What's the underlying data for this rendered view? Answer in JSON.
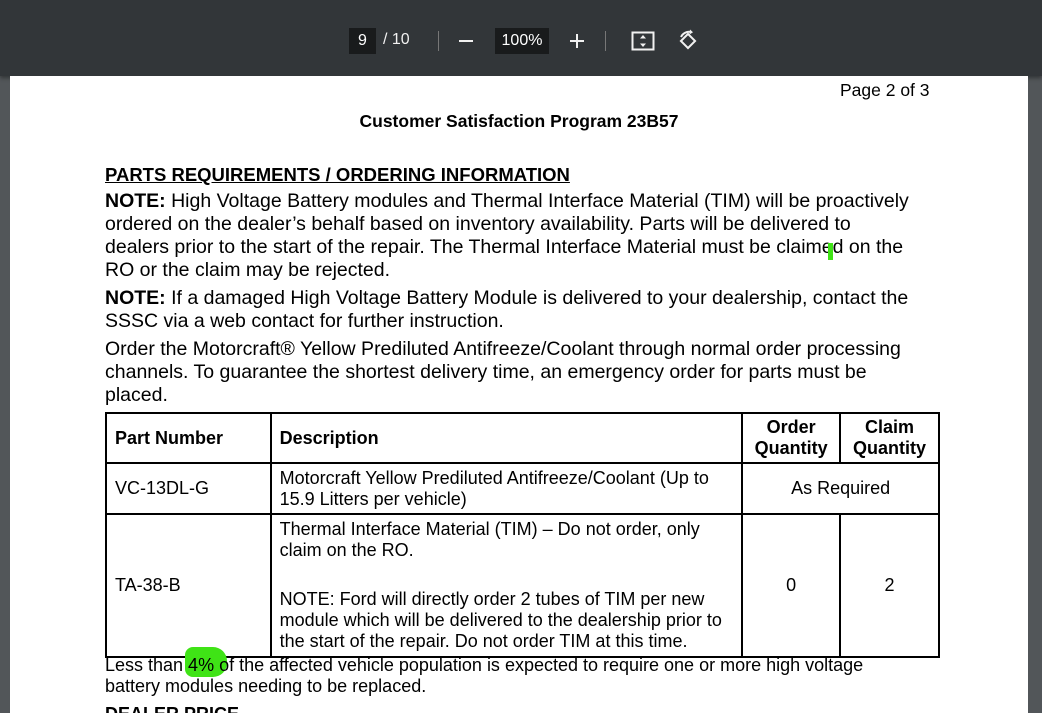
{
  "toolbar": {
    "page_current": "9",
    "page_total": "/ 10",
    "zoom": "100%",
    "icons": [
      "minus-icon",
      "plus-icon",
      "fit-page-icon",
      "rotate-icon"
    ]
  },
  "document": {
    "page_label": "Page 2 of 3",
    "title": "Customer Satisfaction Program 23B57",
    "section_heading": "PARTS REQUIREMENTS / ORDERING INFORMATION",
    "note1_label": "NOTE:",
    "note1_lines": [
      " High Voltage Battery modules and Thermal Interface Material (TIM) will be proactively",
      "ordered on the dealer’s behalf based on inventory availability. Parts will be delivered to",
      "dealers prior to the start of the repair. The Thermal Interface Material must be claimed on the",
      "RO or the claim may be rejected."
    ],
    "note2_label": "NOTE:",
    "note2_lines": [
      " If a damaged High Voltage Battery Module is delivered to your dealership, contact the",
      "SSSC via a web contact for further instruction."
    ],
    "order_lines": [
      "Order the Motorcraft® Yellow Prediluted Antifreeze/Coolant through normal order processing",
      "channels. To guarantee the shortest delivery time, an emergency order for parts must be",
      "placed."
    ],
    "table": {
      "headers": {
        "part_number": "Part Number",
        "description": "Description",
        "order_qty_line1": "Order",
        "order_qty_line2": "Quantity",
        "claim_qty_line1": "Claim",
        "claim_qty_line2": "Quantity"
      },
      "rows": [
        {
          "part_number": "VC-13DL-G",
          "description_lines": [
            "Motorcraft Yellow Prediluted Antifreeze/Coolant (Up to",
            "15.9 Litters per vehicle)"
          ],
          "quantity_merged": "As Required"
        },
        {
          "part_number": "TA-38-B",
          "description_lines": [
            "Thermal Interface Material (TIM) – Do not order, only",
            "claim on the RO."
          ],
          "description_note_lines": [
            "NOTE: Ford will directly order 2 tubes of TIM per new",
            "module which will be delivered to the dealership prior to",
            "the start of the repair. Do not order TIM at this time."
          ],
          "order_qty": "0",
          "claim_qty": "2"
        }
      ]
    },
    "footer_lines": [
      "Less than 4% of the affected vehicle population is expected to require one or more high voltage",
      "battery modules needing to be replaced."
    ],
    "cut_heading": "DEALER PRICE",
    "highlight_color": "#3fe316"
  }
}
